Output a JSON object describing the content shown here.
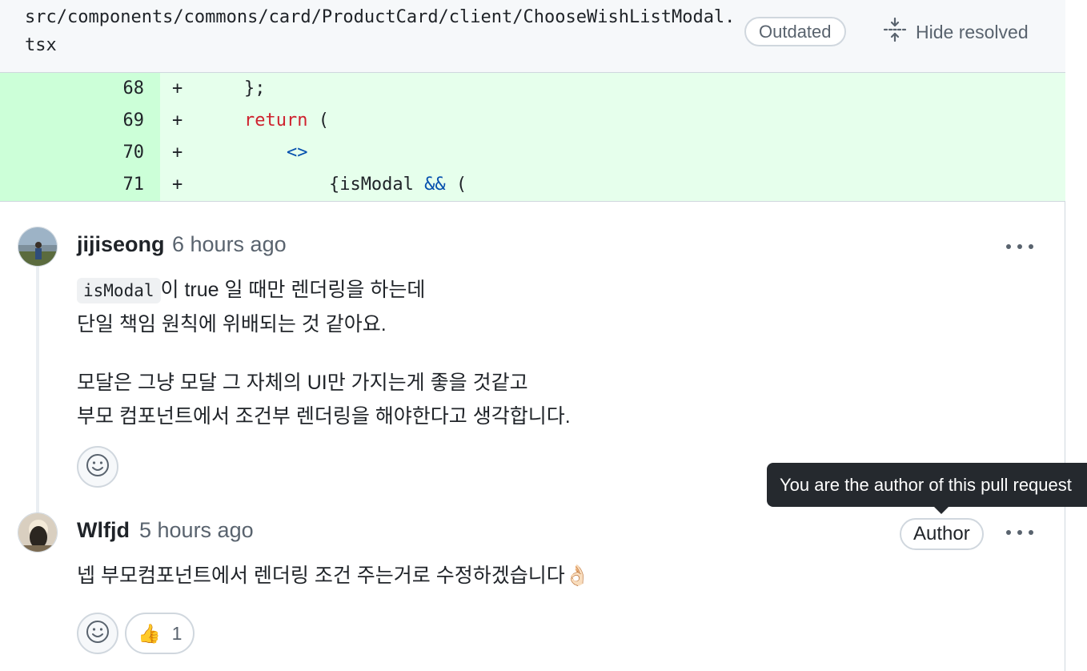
{
  "file": {
    "path": "src/components/commons/card/ProductCard/client/ChooseWishListModal.tsx",
    "outdated_label": "Outdated",
    "hide_resolved_label": "Hide resolved"
  },
  "diff": {
    "lines": [
      {
        "num": "68",
        "sign": "+",
        "indent": "    ",
        "code": "};"
      },
      {
        "num": "69",
        "sign": "+",
        "indent": "    ",
        "keyword": "return",
        "rest": " ("
      },
      {
        "num": "70",
        "sign": "+",
        "indent": "        ",
        "op": "<>"
      },
      {
        "num": "71",
        "sign": "+",
        "indent": "            ",
        "pre": "{isModal ",
        "op": "&&",
        "rest": " ("
      }
    ]
  },
  "comments": [
    {
      "author": "jijiseong",
      "time": "6 hours ago",
      "inline_code": "isModal",
      "line1_rest": "이 true 일 때만 렌더링을 하는데",
      "line2": "단일 책임 원칙에 위배되는 것 같아요.",
      "line3": "모달은 그냥 모달 그 자체의 UI만 가지는게 좋을 것같고",
      "line4": "부모 컴포넌트에서 조건부 렌더링을 해야한다고 생각합니다."
    },
    {
      "author": "Wlfjd",
      "time": "5 hours ago",
      "badge": "Author",
      "text": "넵 부모컴포넌트에서 렌더링 조건 주는거로 수정하겠습니다👌🏻",
      "reaction_emoji": "👍",
      "reaction_count": "1"
    }
  ],
  "tooltip": {
    "text": "You are the author of this pull request"
  },
  "icons": {
    "hide_resolved": "fold-icon",
    "add_reaction": "smiley-icon",
    "more": "kebab-horizontal-icon"
  },
  "colors": {
    "addition_bg": "#e6ffec",
    "addition_num_bg": "#ccffd8",
    "keyword": "#cf222e",
    "operator": "#0550ae",
    "tooltip_bg": "#25292e"
  }
}
